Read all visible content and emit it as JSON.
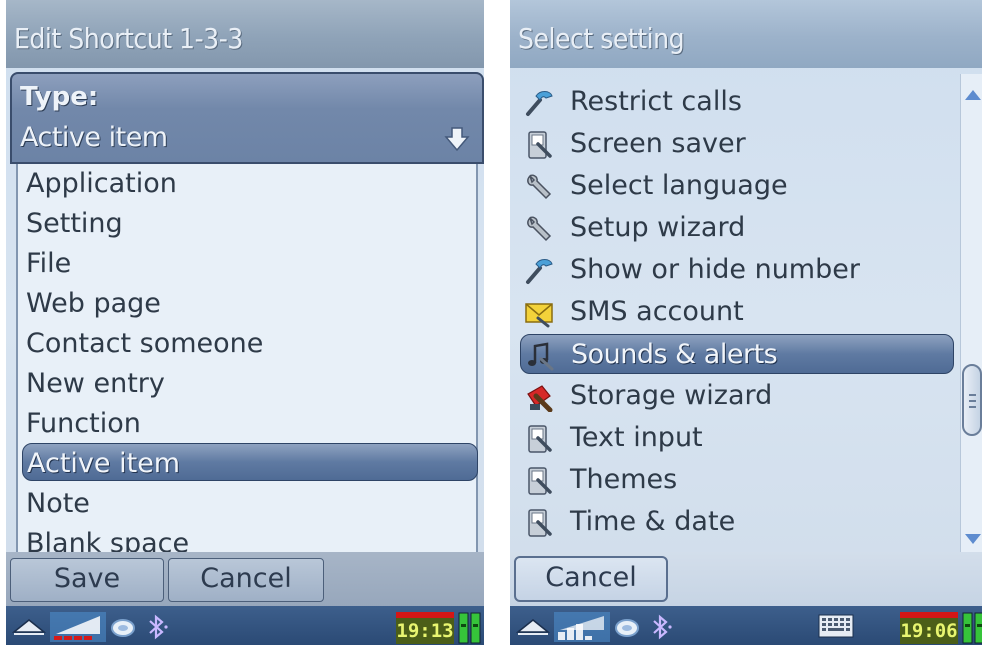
{
  "left": {
    "title": "Edit Shortcut 1-3-3",
    "type_label": "Type:",
    "type_value": "Active item",
    "options": [
      "Application",
      "Setting",
      "File",
      "Web page",
      "Contact someone",
      "New entry",
      "Function",
      "Active item",
      "Note",
      "Blank space"
    ],
    "selected_option": "Active item",
    "softkeys": {
      "save": "Save",
      "cancel": "Cancel"
    },
    "status": {
      "clock": "19:13"
    }
  },
  "right": {
    "title": "Select setting",
    "items": [
      {
        "label": "Restrict calls",
        "icon": "phone-tool-icon"
      },
      {
        "label": "Screen saver",
        "icon": "phone-screen-icon"
      },
      {
        "label": "Select language",
        "icon": "wrench-icon"
      },
      {
        "label": "Setup wizard",
        "icon": "wrench-icon"
      },
      {
        "label": "Show or hide number",
        "icon": "phone-tool-icon"
      },
      {
        "label": "SMS account",
        "icon": "envelope-icon"
      },
      {
        "label": "Sounds & alerts",
        "icon": "music-note-icon"
      },
      {
        "label": "Storage wizard",
        "icon": "storage-icon"
      },
      {
        "label": "Text input",
        "icon": "phone-screen-icon"
      },
      {
        "label": "Themes",
        "icon": "phone-screen-icon"
      },
      {
        "label": "Time & date",
        "icon": "phone-screen-icon"
      }
    ],
    "selected_item": "Sounds & alerts",
    "softkeys": {
      "cancel": "Cancel"
    },
    "status": {
      "clock": "19:06"
    }
  },
  "colors": {
    "selection": "#5f7aa2",
    "status_bar": "#2b4a75",
    "clock_bg": "#4b5e18",
    "battery_green": "#36c43a"
  }
}
